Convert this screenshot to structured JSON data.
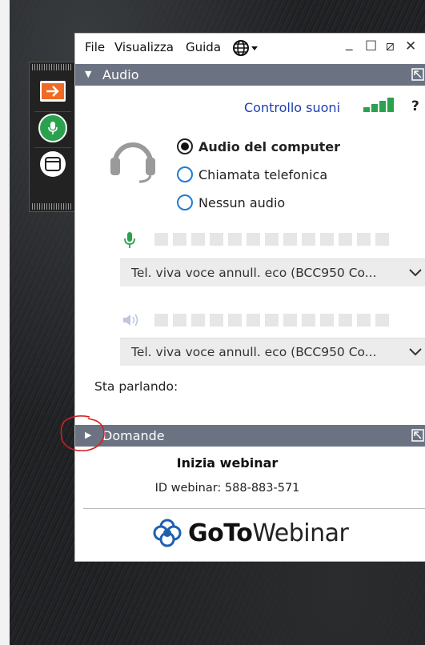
{
  "menu": {
    "file": "File",
    "visualizza": "Visualizza",
    "guida": "Guida",
    "language_icon": "globe-icon"
  },
  "window_controls": {
    "minimize": "_",
    "maximize": "☐",
    "restore": "⧄",
    "close": "✕"
  },
  "control_strip": {
    "items": [
      "show-panel-arrow-icon",
      "microphone-icon",
      "screen-icon"
    ]
  },
  "audio_section": {
    "title": "Audio",
    "sound_check": "Controllo suoni",
    "help": "?",
    "options": [
      {
        "label": "Audio del computer",
        "selected": true
      },
      {
        "label": "Chiamata telefonica",
        "selected": false
      },
      {
        "label": "Nessun audio",
        "selected": false
      }
    ],
    "microphone_device": "Tel. viva voce annull. eco (BCC950 Co...",
    "speaker_device": "Tel. viva voce annull. eco (BCC950 Co...",
    "speaking_label": "Sta parlando:"
  },
  "questions_section": {
    "title": "Domande"
  },
  "webinar": {
    "title": "Inizia webinar",
    "id_label": "ID webinar: 588-883-571"
  },
  "logo": {
    "bold": "GoTo",
    "light": "Webinar"
  },
  "colors": {
    "section_bar": "#6b7282",
    "accent_orange": "#ef6a24",
    "accent_green": "#2aa24d",
    "link_blue": "#1d3fb0",
    "annotation_red": "#d22020"
  }
}
